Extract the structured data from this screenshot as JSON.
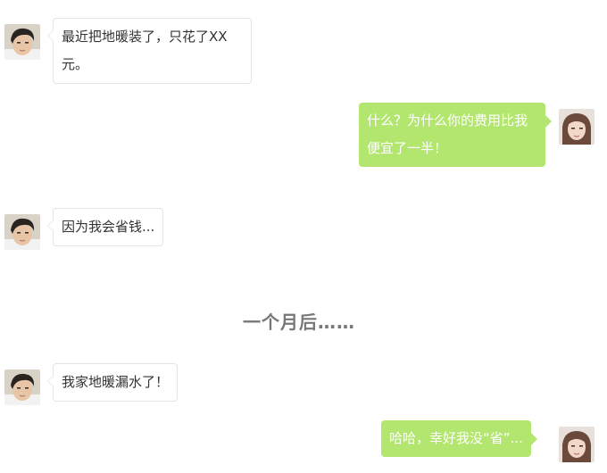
{
  "messages": [
    {
      "side": "left",
      "sender": "male",
      "text": "最近把地暖装了，只花了XX元。"
    },
    {
      "side": "right",
      "sender": "female",
      "text": "什么？为什么你的费用比我便宜了一半！"
    },
    {
      "side": "left",
      "sender": "male",
      "text": "因为我会省钱..."
    },
    {
      "side": "left",
      "sender": "male",
      "text": "我家地暖漏水了！"
    },
    {
      "side": "right",
      "sender": "female",
      "text": "哈哈，幸好我没“省”..."
    }
  ],
  "divider": {
    "text": "一个月后……"
  },
  "colors": {
    "outgoing_bubble": "#b3e66e",
    "incoming_bubble": "#ffffff",
    "incoming_border": "#e3e3e3",
    "divider_text": "#777777"
  },
  "icons": {
    "male_avatar": "male-avatar-icon",
    "female_avatar": "female-avatar-icon"
  }
}
